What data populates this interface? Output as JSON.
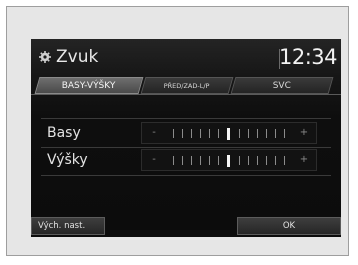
{
  "header": {
    "title": "Zvuk",
    "clock": "12:34",
    "icon": "gear-icon"
  },
  "tabs": [
    {
      "label": "BASY-VÝŠKY",
      "active": true
    },
    {
      "label": "PŘED/ZAD-L/P",
      "active": false
    },
    {
      "label": "SVC",
      "active": false
    }
  ],
  "settings": [
    {
      "label": "Basy",
      "minus": "-",
      "plus": "+",
      "level": 0,
      "range": [
        -6,
        6
      ]
    },
    {
      "label": "Výšky",
      "minus": "-",
      "plus": "+",
      "level": 0,
      "range": [
        -6,
        6
      ]
    }
  ],
  "footer": {
    "reset_label": "Vých. nast.",
    "ok_label": "OK"
  },
  "colors": {
    "screen_bg": "#0c0c0c",
    "active_tab": "#5a5a5a",
    "slider_marker": "#f5f5f5"
  }
}
